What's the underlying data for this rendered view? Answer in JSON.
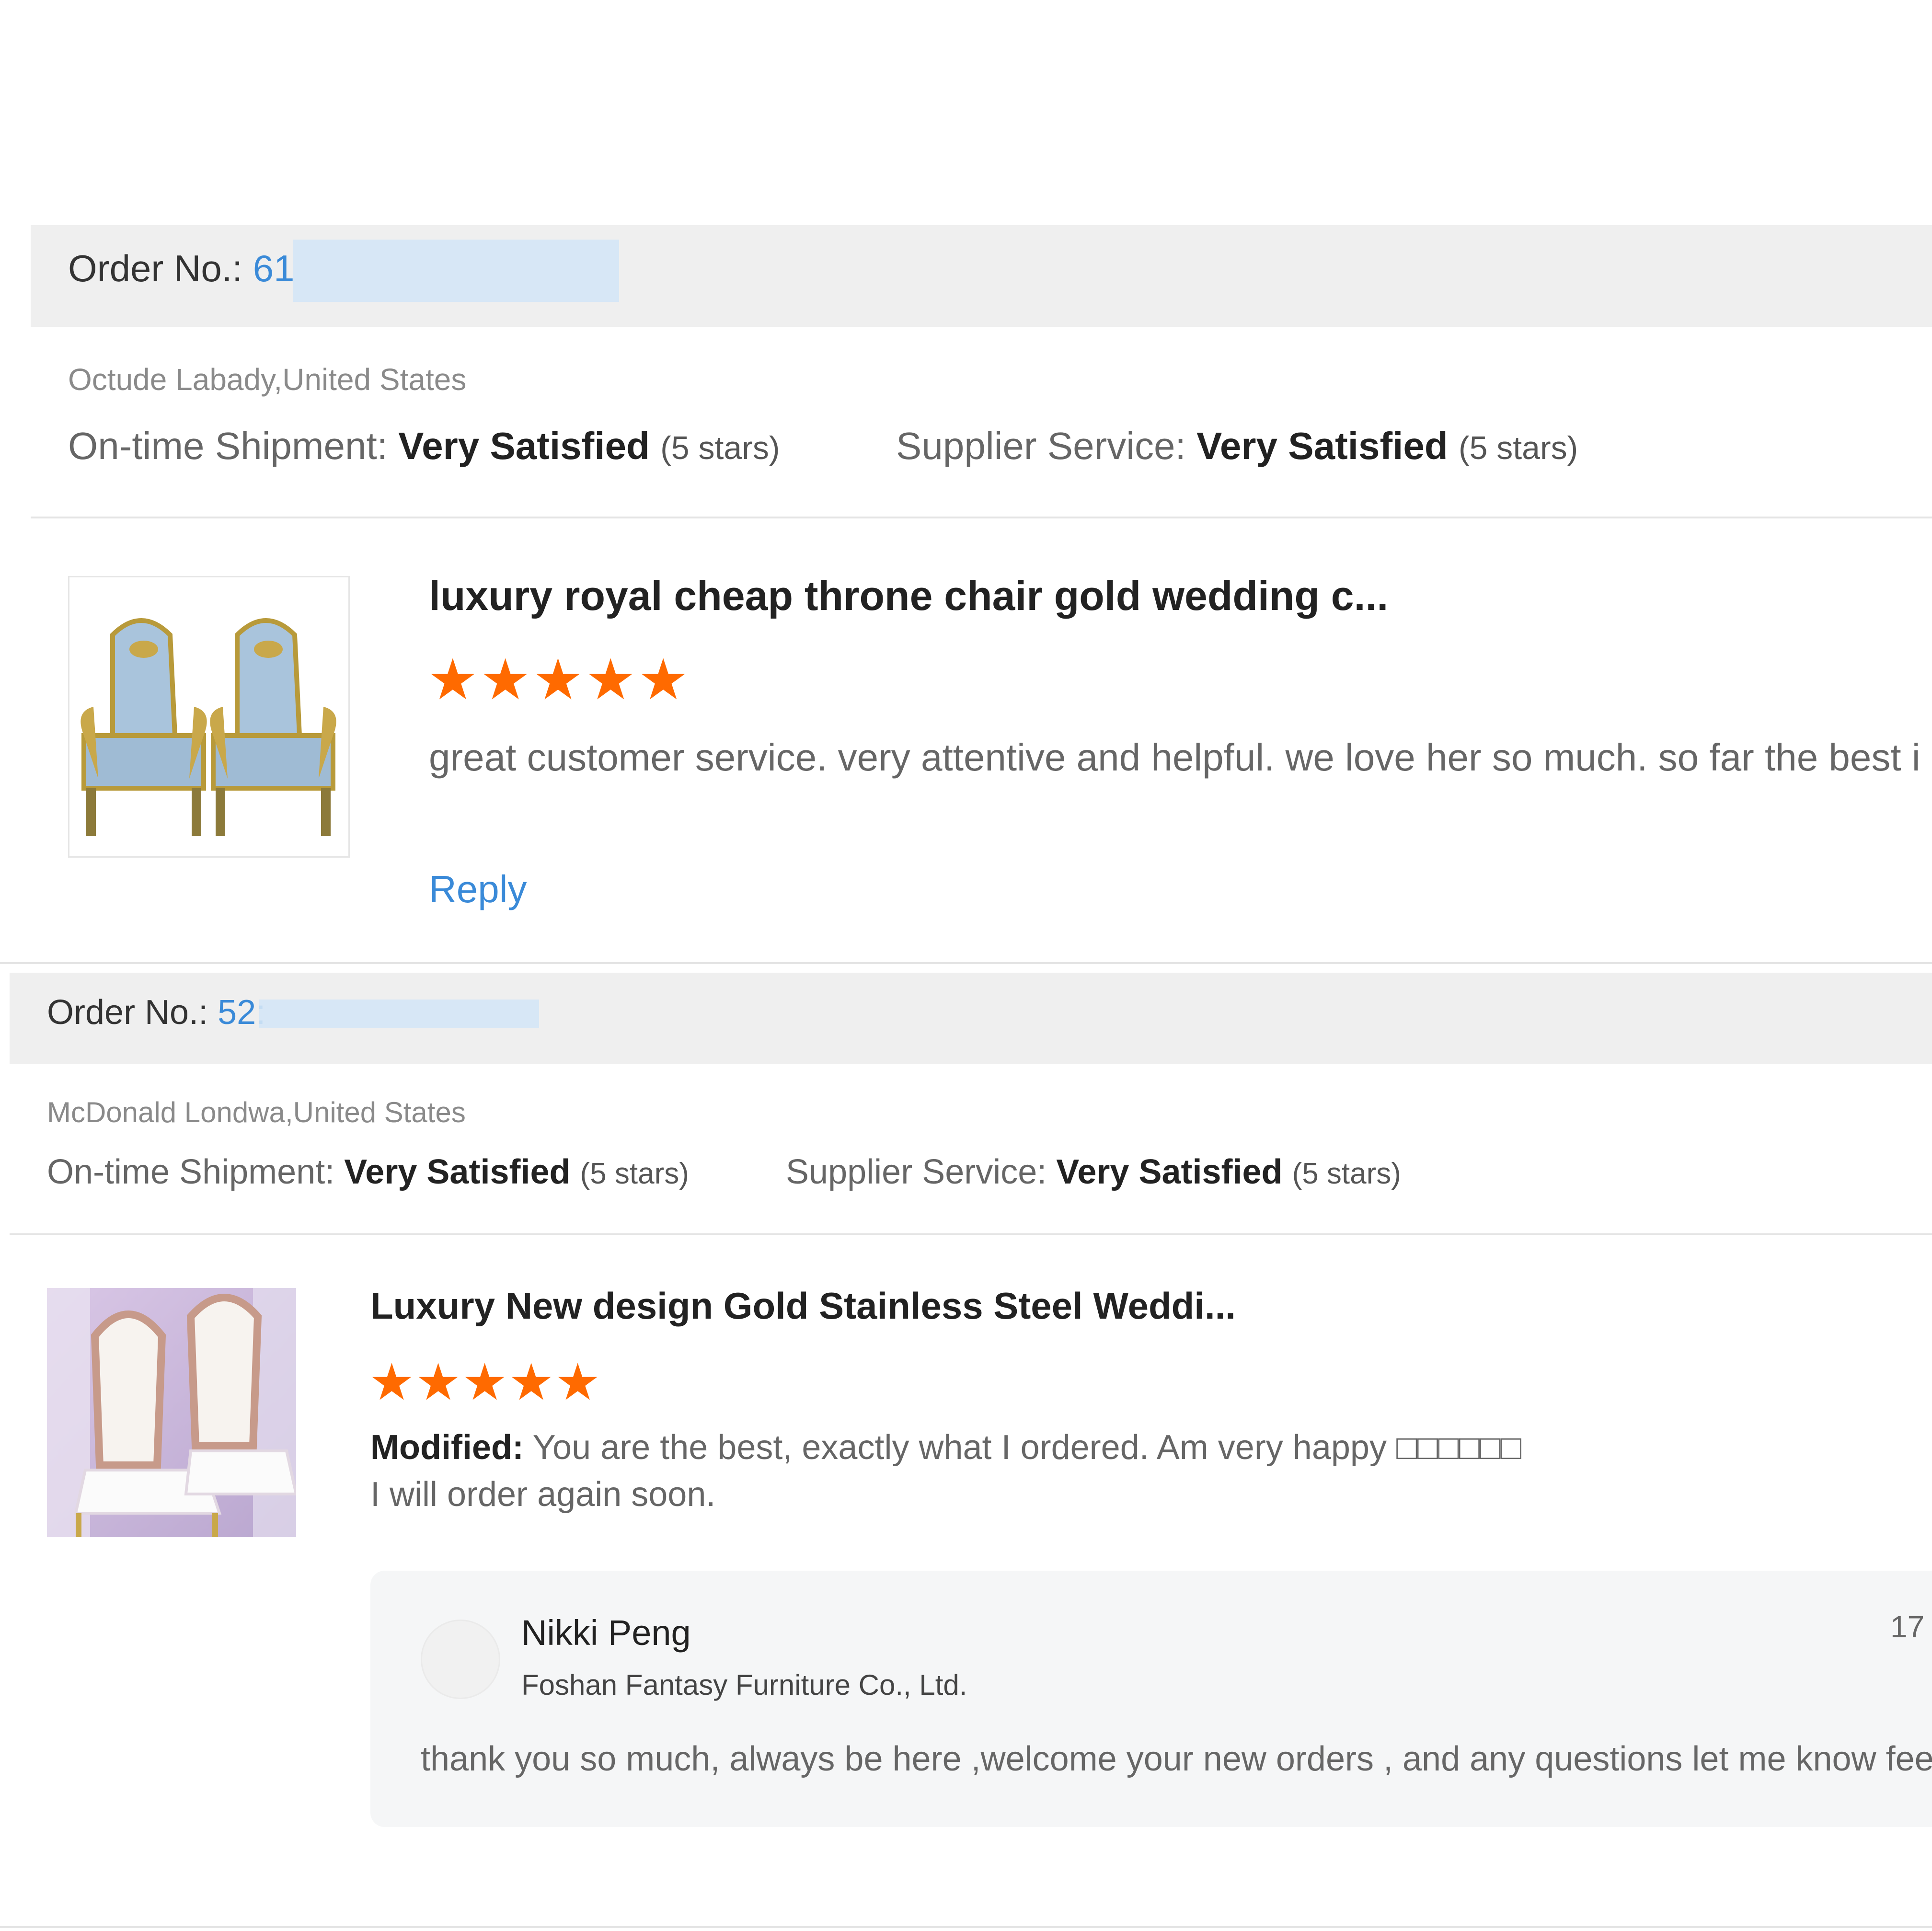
{
  "reviews": [
    {
      "order_label": "Order No.:",
      "order_no": "61",
      "buyer": "Octude Labady,United States",
      "shipment_label": "On-time Shipment:",
      "shipment_value": "Very Satisfied",
      "shipment_stars": "(5 stars)",
      "service_label": "Supplier Service:",
      "service_value": "Very Satisfied",
      "service_stars": "(5 stars)",
      "product_title": "luxury royal cheap throne chair gold wedding c...",
      "rating": 5,
      "comment": "great customer service. very attentive and helpful. we love her so much. so far the best i",
      "reply_link": "Reply"
    },
    {
      "order_label": "Order No.:",
      "order_no": "52:",
      "buyer": "McDonald Londwa,United States",
      "shipment_label": "On-time Shipment:",
      "shipment_value": "Very Satisfied",
      "shipment_stars": "(5 stars)",
      "service_label": "Supplier Service:",
      "service_value": "Very Satisfied",
      "service_stars": "(5 stars)",
      "product_title": "Luxury New design Gold Stainless Steel Weddi...",
      "rating": 5,
      "modified_label": "Modified:",
      "comment_line1": "You are the best, exactly what I ordered. Am very happy □□□□□□",
      "comment_line2": "I will order again soon.",
      "supplier_reply": {
        "name": "Nikki Peng",
        "company": "Foshan Fantasy Furniture Co., Ltd.",
        "date": "17",
        "text": "thank you so much, always be here ,welcome your new orders , and any questions let me know feel"
      }
    }
  ],
  "icons": {
    "star": "star-icon",
    "avatar": "avatar-icon"
  },
  "colors": {
    "accent": "#3a8ad8",
    "star": "#ff6a00",
    "header_bg": "#efefef"
  }
}
